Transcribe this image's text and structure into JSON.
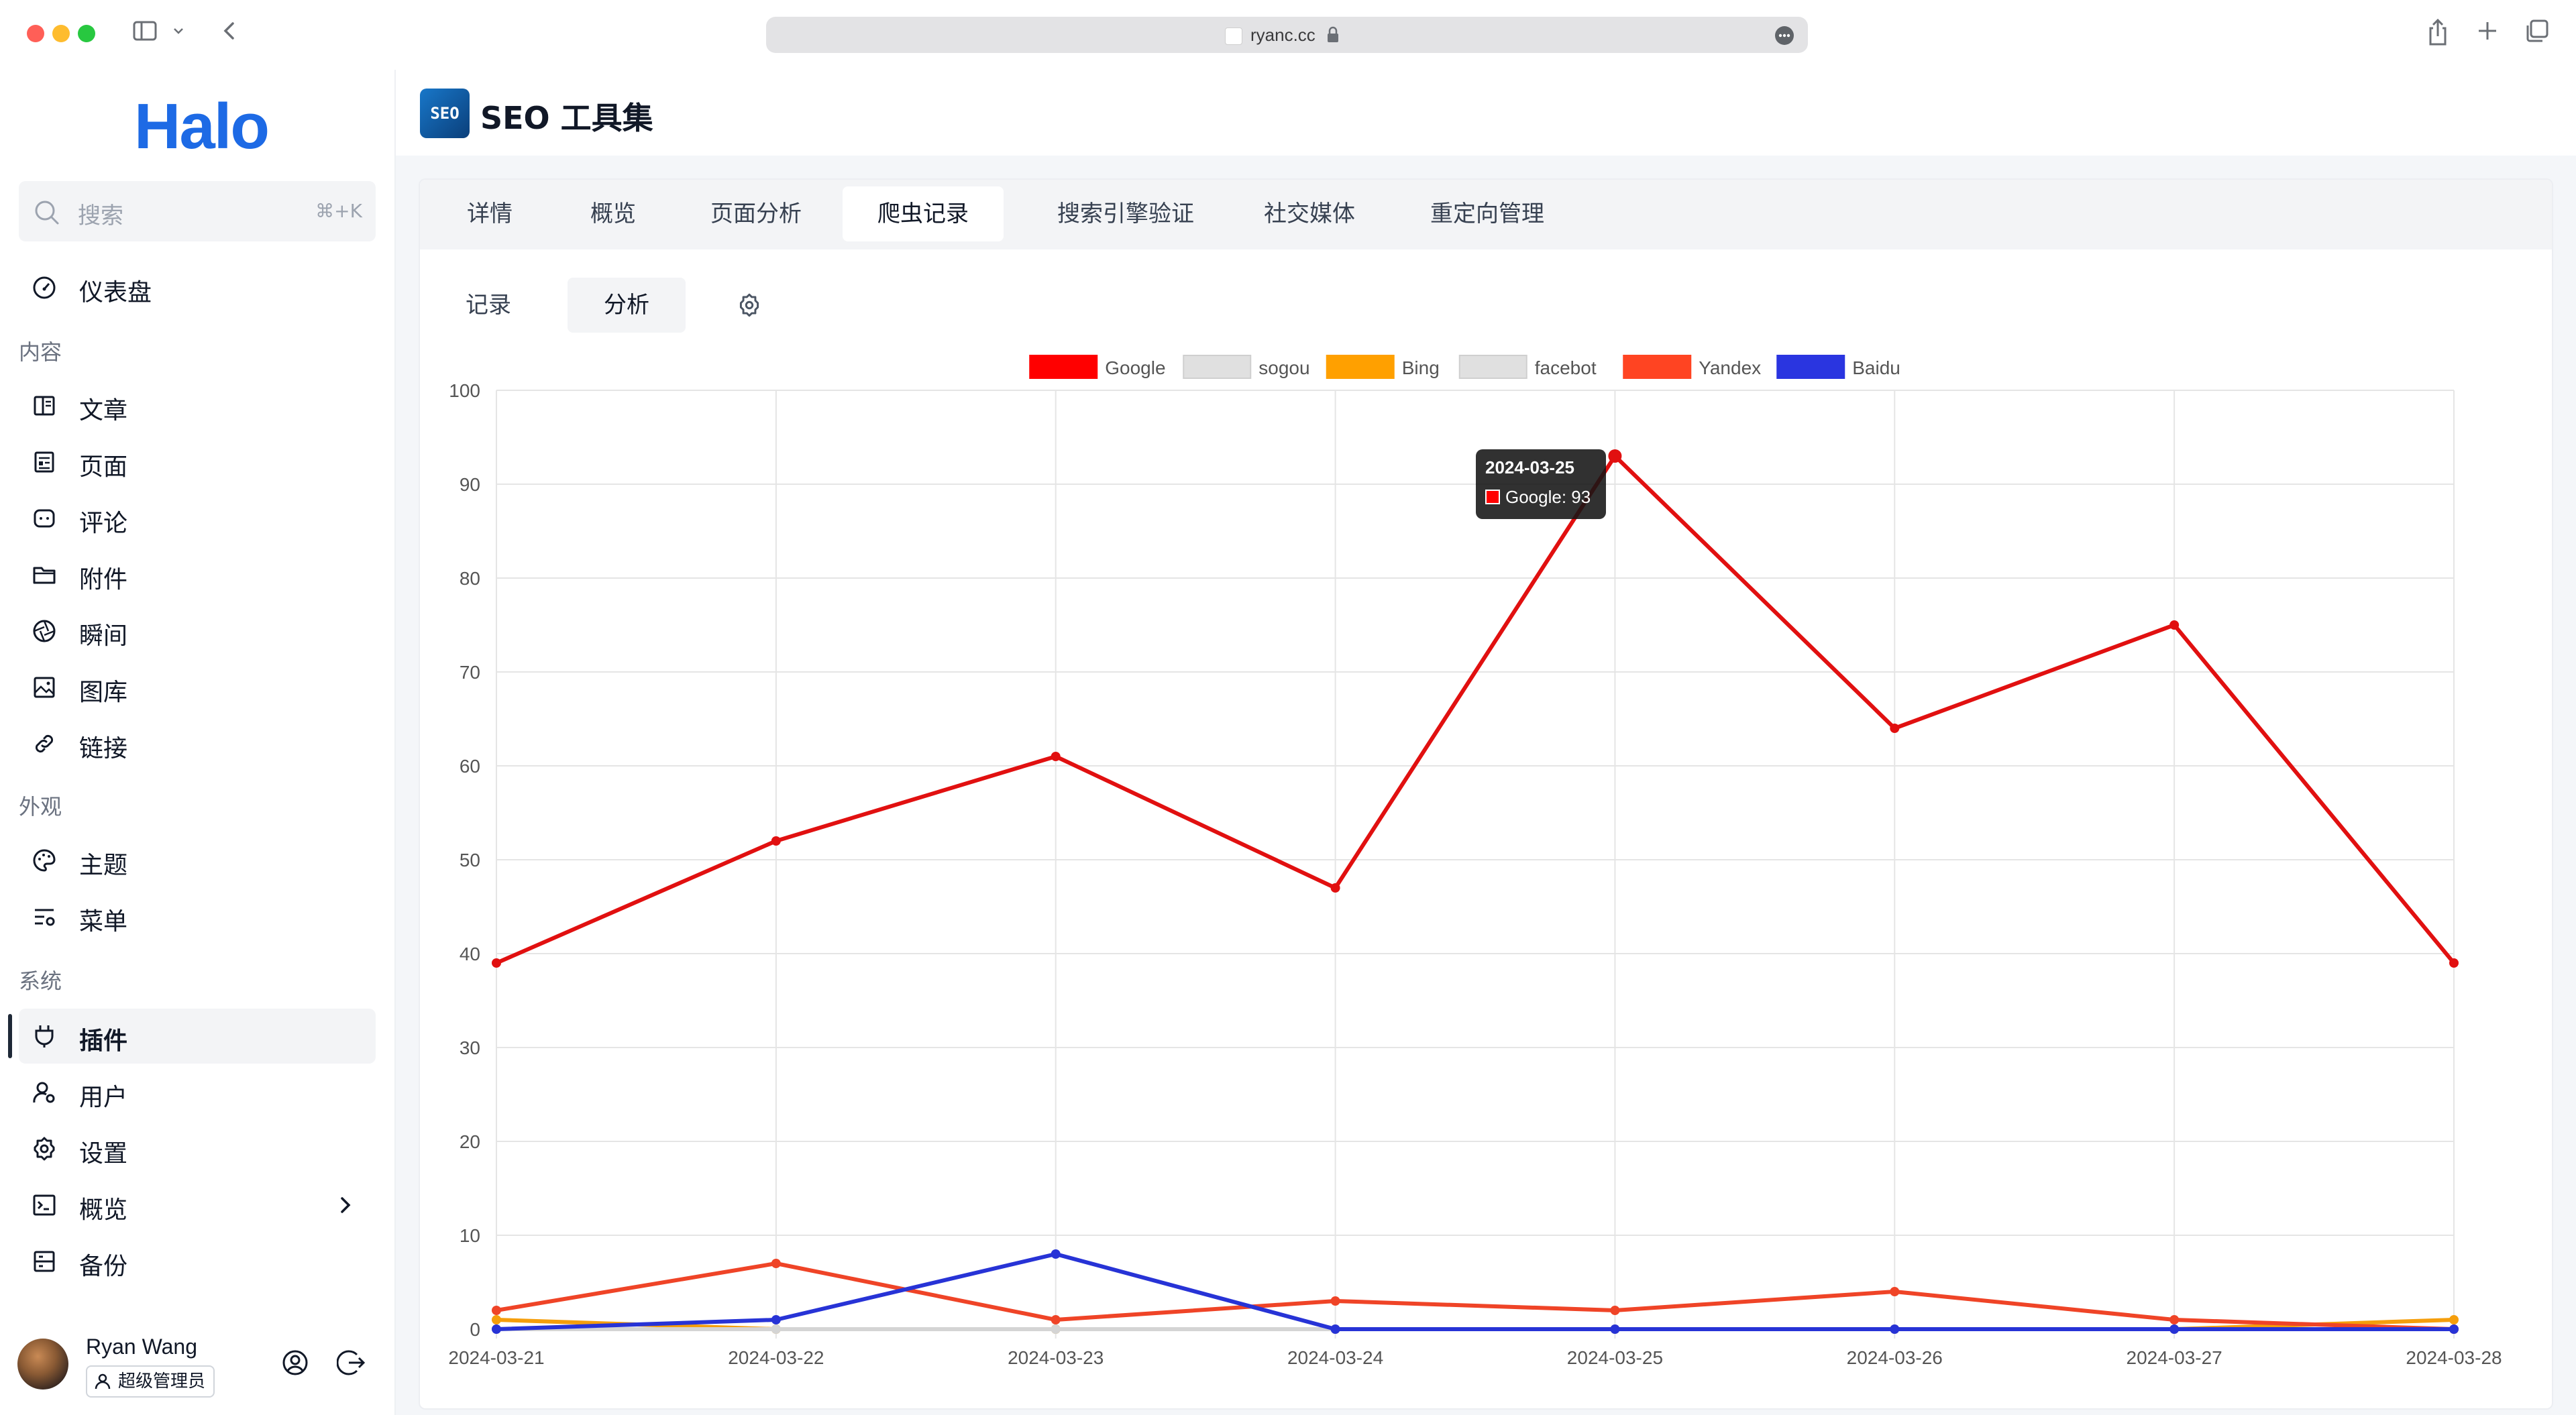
{
  "browser": {
    "url": "ryanc.cc"
  },
  "sidebar": {
    "logo": "Halo",
    "search": {
      "placeholder": "搜索",
      "shortcut": "⌘+K"
    },
    "dashboard": "仪表盘",
    "groups": {
      "content": "内容",
      "appearance": "外观",
      "system": "系统"
    },
    "items": {
      "posts": "文章",
      "pages": "页面",
      "comments": "评论",
      "attachments": "附件",
      "moments": "瞬间",
      "gallery": "图库",
      "links": "链接",
      "themes": "主题",
      "menus": "菜单",
      "plugins": "插件",
      "users": "用户",
      "settings": "设置",
      "overview": "概览",
      "backup": "备份"
    },
    "user": {
      "name": "Ryan Wang",
      "role": "超级管理员"
    }
  },
  "header": {
    "plugin_logo": "SEO",
    "title": "SEO 工具集"
  },
  "tabs": [
    "详情",
    "概览",
    "页面分析",
    "爬虫记录",
    "搜索引擎验证",
    "社交媒体",
    "重定向管理"
  ],
  "active_tab": "爬虫记录",
  "subtabs": [
    "记录",
    "分析"
  ],
  "active_subtab": "分析",
  "tooltip": {
    "date": "2024-03-25",
    "label": "Google: 93"
  },
  "chart_data": {
    "type": "line",
    "x": [
      "2024-03-21",
      "2024-03-22",
      "2024-03-23",
      "2024-03-24",
      "2024-03-25",
      "2024-03-26",
      "2024-03-27",
      "2024-03-28"
    ],
    "ylim": [
      0,
      100
    ],
    "yticks": [
      0,
      10,
      20,
      30,
      40,
      50,
      60,
      70,
      80,
      90,
      100
    ],
    "grid": true,
    "legend": "top-center",
    "series": [
      {
        "name": "Google",
        "color": "#ff0000",
        "line_color": "#e11010",
        "values": [
          39,
          52,
          61,
          47,
          93,
          64,
          75,
          39
        ]
      },
      {
        "name": "sogou",
        "color": "#e0e0e0",
        "line_color": "#d4d4d4",
        "values": [
          0,
          0,
          0,
          0,
          0,
          0,
          0,
          0
        ]
      },
      {
        "name": "Bing",
        "color": "#ffa000",
        "line_color": "#f59e0b",
        "values": [
          1,
          0,
          0,
          0,
          0,
          0,
          0,
          1
        ]
      },
      {
        "name": "facebot",
        "color": "#e0e0e0",
        "line_color": "#d4d4d4",
        "values": [
          0,
          0,
          0,
          0,
          0,
          0,
          0,
          0
        ]
      },
      {
        "name": "Yandex",
        "color": "#ff4422",
        "line_color": "#ef4427",
        "values": [
          2,
          7,
          1,
          3,
          2,
          4,
          1,
          0
        ]
      },
      {
        "name": "Baidu",
        "color": "#2a35e0",
        "line_color": "#2733d6",
        "values": [
          0,
          1,
          8,
          0,
          0,
          0,
          0,
          0
        ]
      }
    ]
  }
}
